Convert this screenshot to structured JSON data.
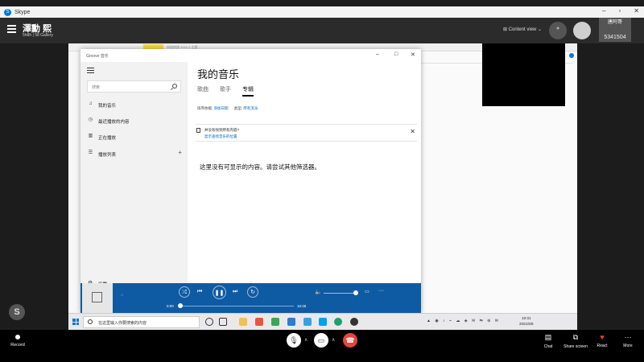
{
  "skype_window": {
    "title": "Skype"
  },
  "call": {
    "name": "澤勳 熙",
    "subtitle": "5h8h | 58 Gallery",
    "content_view_label": "Content view",
    "participant_tile": {
      "name": "唐阿哥",
      "number": "5341504"
    }
  },
  "background_strip": {
    "tab_text": "网络转换 2024 1 主题"
  },
  "music_app": {
    "title": "Groove 音乐",
    "sidebar": {
      "search_placeholder": "搜索",
      "items": [
        {
          "label": "我的音乐",
          "icon": "music-note-icon"
        },
        {
          "label": "最近播放的内容",
          "icon": "clock-icon"
        },
        {
          "label": "正在播放",
          "icon": "bars-icon"
        },
        {
          "label": "播放列表",
          "icon": "list-icon"
        }
      ],
      "settings_label": "设置"
    },
    "heading": "我的音乐",
    "tabs": [
      {
        "label": "歌曲",
        "active": false
      },
      {
        "label": "歌手",
        "active": false
      },
      {
        "label": "专辑",
        "active": true
      }
    ],
    "sort": {
      "sort_label": "排序依据:",
      "sort_value": "添加日期",
      "type_label": "类型:",
      "type_value": "所有流派"
    },
    "info_bar": {
      "line1": "并没有找到所有内容?",
      "line2": "显示查找音乐的位置"
    },
    "empty_message": "这里没有可显示的内容。请尝试其他筛选器。",
    "player": {
      "time_elapsed": "0:00",
      "time_total": "16:36"
    }
  },
  "taskbar": {
    "search_placeholder": "在这里输入你要搜索的内容",
    "clock_time": "10:31",
    "clock_date": "2021/5/8"
  },
  "toolbar": {
    "record_label": "Record",
    "chat_label": "Chat",
    "share_label": "Share screen",
    "react_label": "React",
    "more_label": "More"
  },
  "colors": {
    "accent": "#0f5ba3",
    "end_call": "#e3453c",
    "skype_blue": "#0078d4"
  }
}
